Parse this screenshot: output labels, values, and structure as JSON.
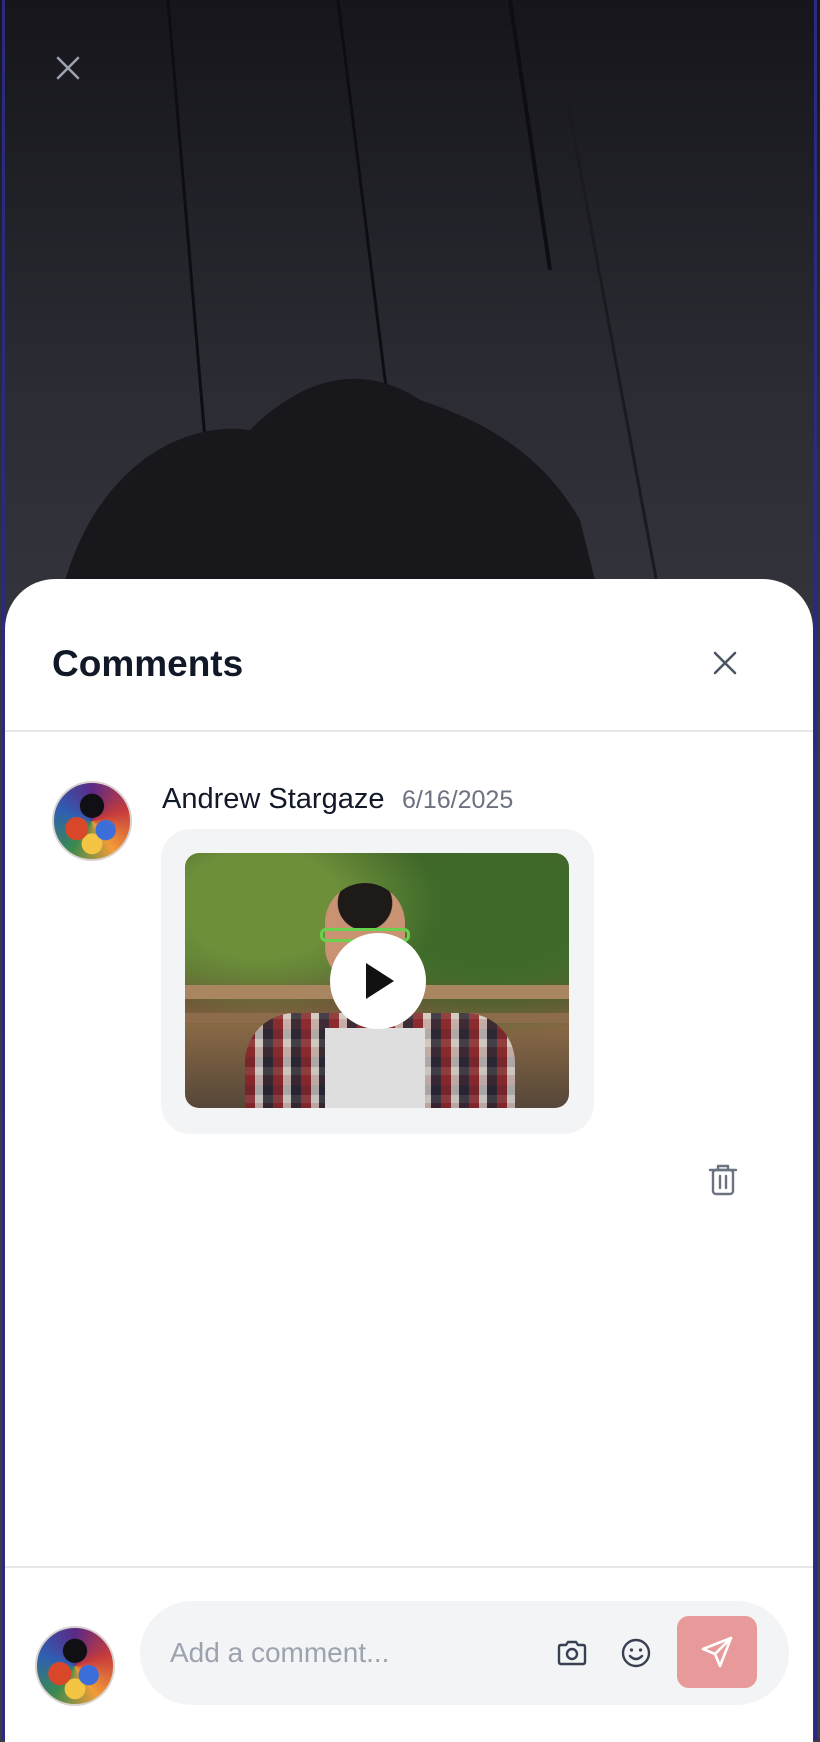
{
  "background": {
    "close_icon": "close-icon"
  },
  "comments_sheet": {
    "title": "Comments",
    "close_icon": "close-icon",
    "comments": [
      {
        "author": "Andrew Stargaze",
        "date": "6/16/2025",
        "attachment_type": "video",
        "play_icon": "play-icon",
        "delete_icon": "trash-icon"
      }
    ]
  },
  "composer": {
    "placeholder": "Add a comment...",
    "value": "",
    "camera_icon": "camera-icon",
    "emoji_icon": "smile-icon",
    "send_icon": "send-icon"
  },
  "colors": {
    "send_button": "#e8999a",
    "text_primary": "#111827",
    "text_muted": "#6b7280",
    "card_background": "#f3f4f6",
    "divider": "#e5e7eb"
  }
}
